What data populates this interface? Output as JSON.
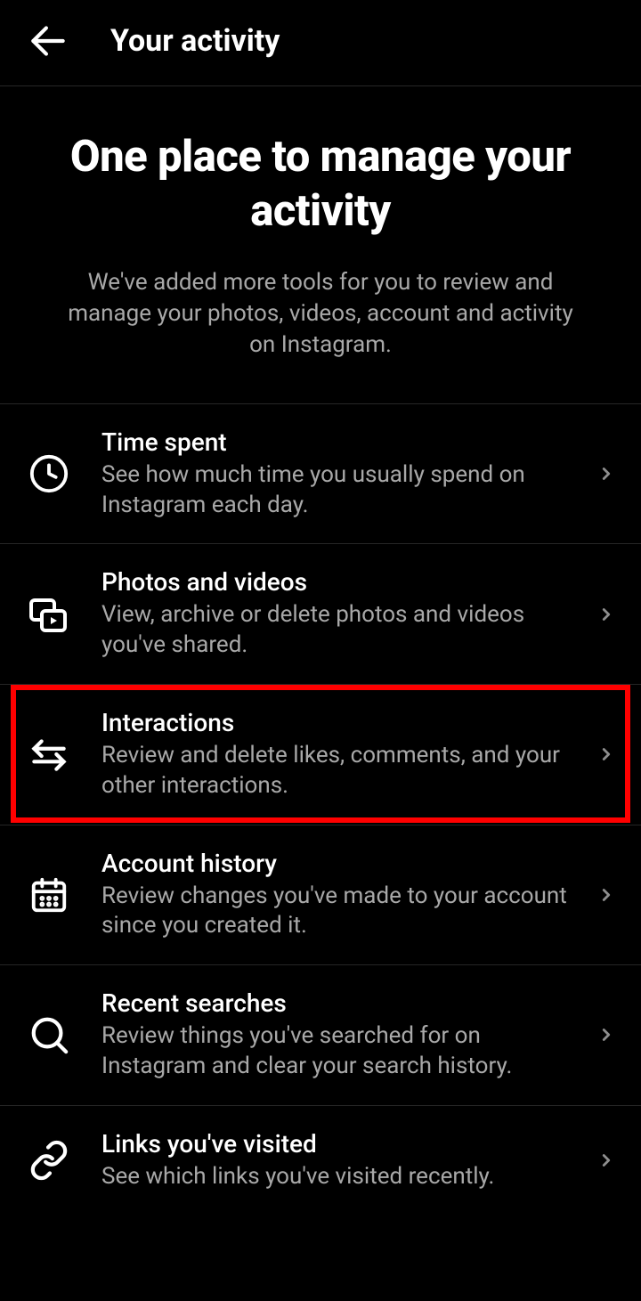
{
  "header": {
    "title": "Your activity"
  },
  "intro": {
    "title": "One place to manage your activity",
    "subtitle": "We've added more tools for you to review and manage your photos, videos, account and activity on Instagram."
  },
  "items": [
    {
      "icon": "clock-icon",
      "title": "Time spent",
      "subtitle": "See how much time you usually spend on Instagram each day.",
      "highlighted": false
    },
    {
      "icon": "media-icon",
      "title": "Photos and videos",
      "subtitle": "View, archive or delete photos and videos you've shared.",
      "highlighted": false
    },
    {
      "icon": "arrows-icon",
      "title": "Interactions",
      "subtitle": "Review and delete likes, comments, and your other interactions.",
      "highlighted": true
    },
    {
      "icon": "calendar-icon",
      "title": "Account history",
      "subtitle": "Review changes you've made to your account since you created it.",
      "highlighted": false
    },
    {
      "icon": "search-icon",
      "title": "Recent searches",
      "subtitle": "Review things you've searched for on Instagram and clear your search history.",
      "highlighted": false
    },
    {
      "icon": "link-icon",
      "title": "Links you've visited",
      "subtitle": "See which links you've visited recently.",
      "highlighted": false
    }
  ]
}
